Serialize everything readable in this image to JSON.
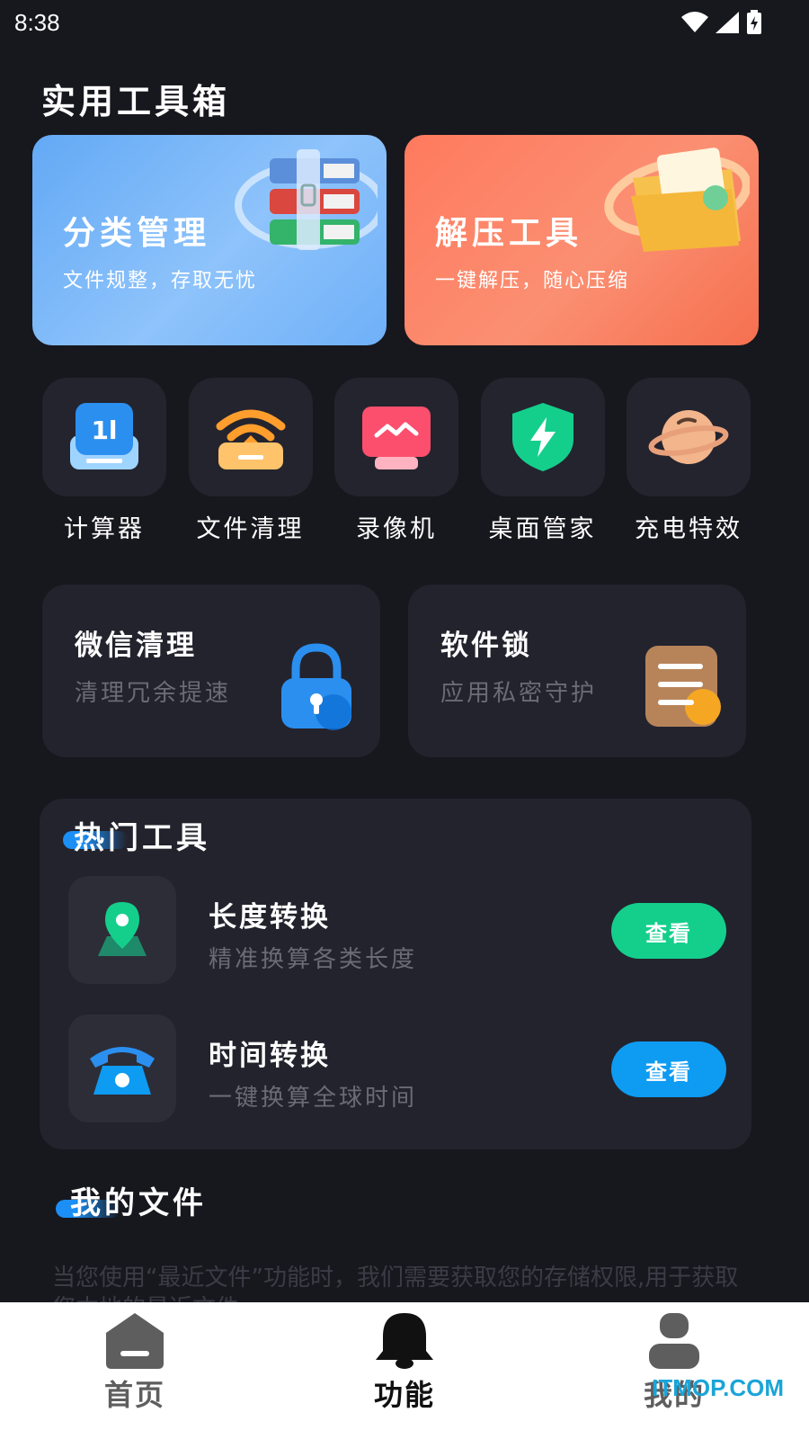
{
  "status_bar": {
    "time": "8:38",
    "icons": [
      "wifi-icon",
      "signal-icon",
      "battery-charging-icon"
    ]
  },
  "page_title": "实用工具箱",
  "feature_cards": [
    {
      "title": "分类管理",
      "subtitle": "文件规整，存取无忧",
      "icon": "books-folder-icon",
      "color": "#6fb0f8"
    },
    {
      "title": "解压工具",
      "subtitle": "一键解压，随心压缩",
      "icon": "zip-folder-icon",
      "color": "#fb8f72"
    }
  ],
  "tools": [
    {
      "label": "计算器",
      "icon": "calculator-icon"
    },
    {
      "label": "文件清理",
      "icon": "wifi-clean-icon"
    },
    {
      "label": "录像机",
      "icon": "monitor-icon"
    },
    {
      "label": "桌面管家",
      "icon": "shield-bolt-icon"
    },
    {
      "label": "充电特效",
      "icon": "planet-icon"
    }
  ],
  "mid_cards": [
    {
      "title": "微信清理",
      "subtitle": "清理冗余提速",
      "icon": "padlock-icon"
    },
    {
      "title": "软件锁",
      "subtitle": "应用私密守护",
      "icon": "notes-icon"
    }
  ],
  "hot_tools": {
    "title": "热门工具",
    "items": [
      {
        "name": "长度转换",
        "desc": "精准换算各类长度",
        "button": "查看",
        "icon": "map-pin-icon",
        "button_color": "#14cf8c"
      },
      {
        "name": "时间转换",
        "desc": "一键换算全球时间",
        "button": "查看",
        "icon": "telephone-icon",
        "button_color": "#0e9bf2"
      }
    ]
  },
  "my_files": {
    "title": "我的文件",
    "notice": "当您使用“最近文件”功能时，我们需要获取您的存储权限,用于获取您本地的最近文件"
  },
  "bottom_nav": [
    {
      "label": "首页",
      "icon": "home-icon",
      "active": false
    },
    {
      "label": "功能",
      "icon": "bell-icon",
      "active": true
    },
    {
      "label": "我的",
      "icon": "person-icon",
      "active": false
    }
  ],
  "watermark": "ITMOP.COM"
}
